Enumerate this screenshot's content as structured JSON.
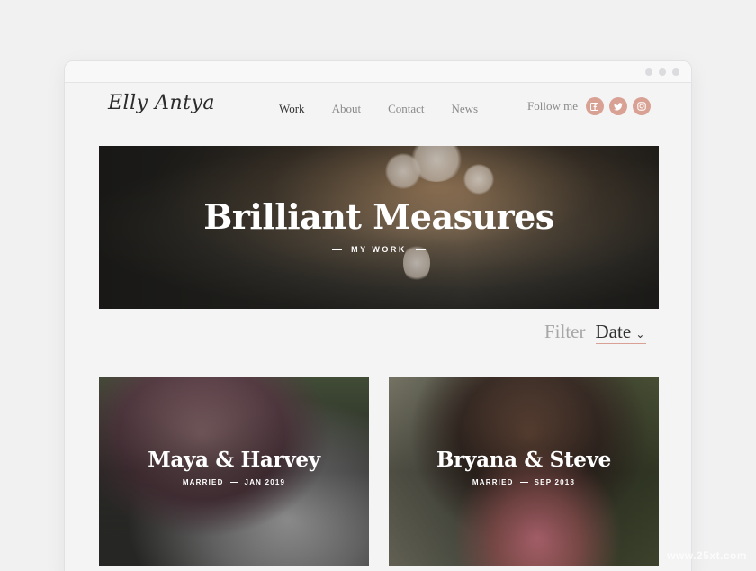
{
  "brand": {
    "logo_text": "Elly Antya"
  },
  "nav": {
    "items": [
      {
        "label": "Work",
        "active": true
      },
      {
        "label": "About",
        "active": false
      },
      {
        "label": "Contact",
        "active": false
      },
      {
        "label": "News",
        "active": false
      }
    ]
  },
  "social": {
    "label": "Follow me",
    "icons": [
      "facebook-icon",
      "twitter-icon",
      "instagram-icon"
    ],
    "accent": "#d9a193"
  },
  "hero": {
    "title": "Brilliant Measures",
    "subtitle": "MY WORK"
  },
  "filter": {
    "label": "Filter",
    "selected": "Date"
  },
  "cards": [
    {
      "title": "Maya & Harvey",
      "status": "MARRIED",
      "date": "JAN 2019"
    },
    {
      "title": "Bryana & Steve",
      "status": "MARRIED",
      "date": "SEP 2018"
    }
  ],
  "watermark": "www.25xt.com"
}
